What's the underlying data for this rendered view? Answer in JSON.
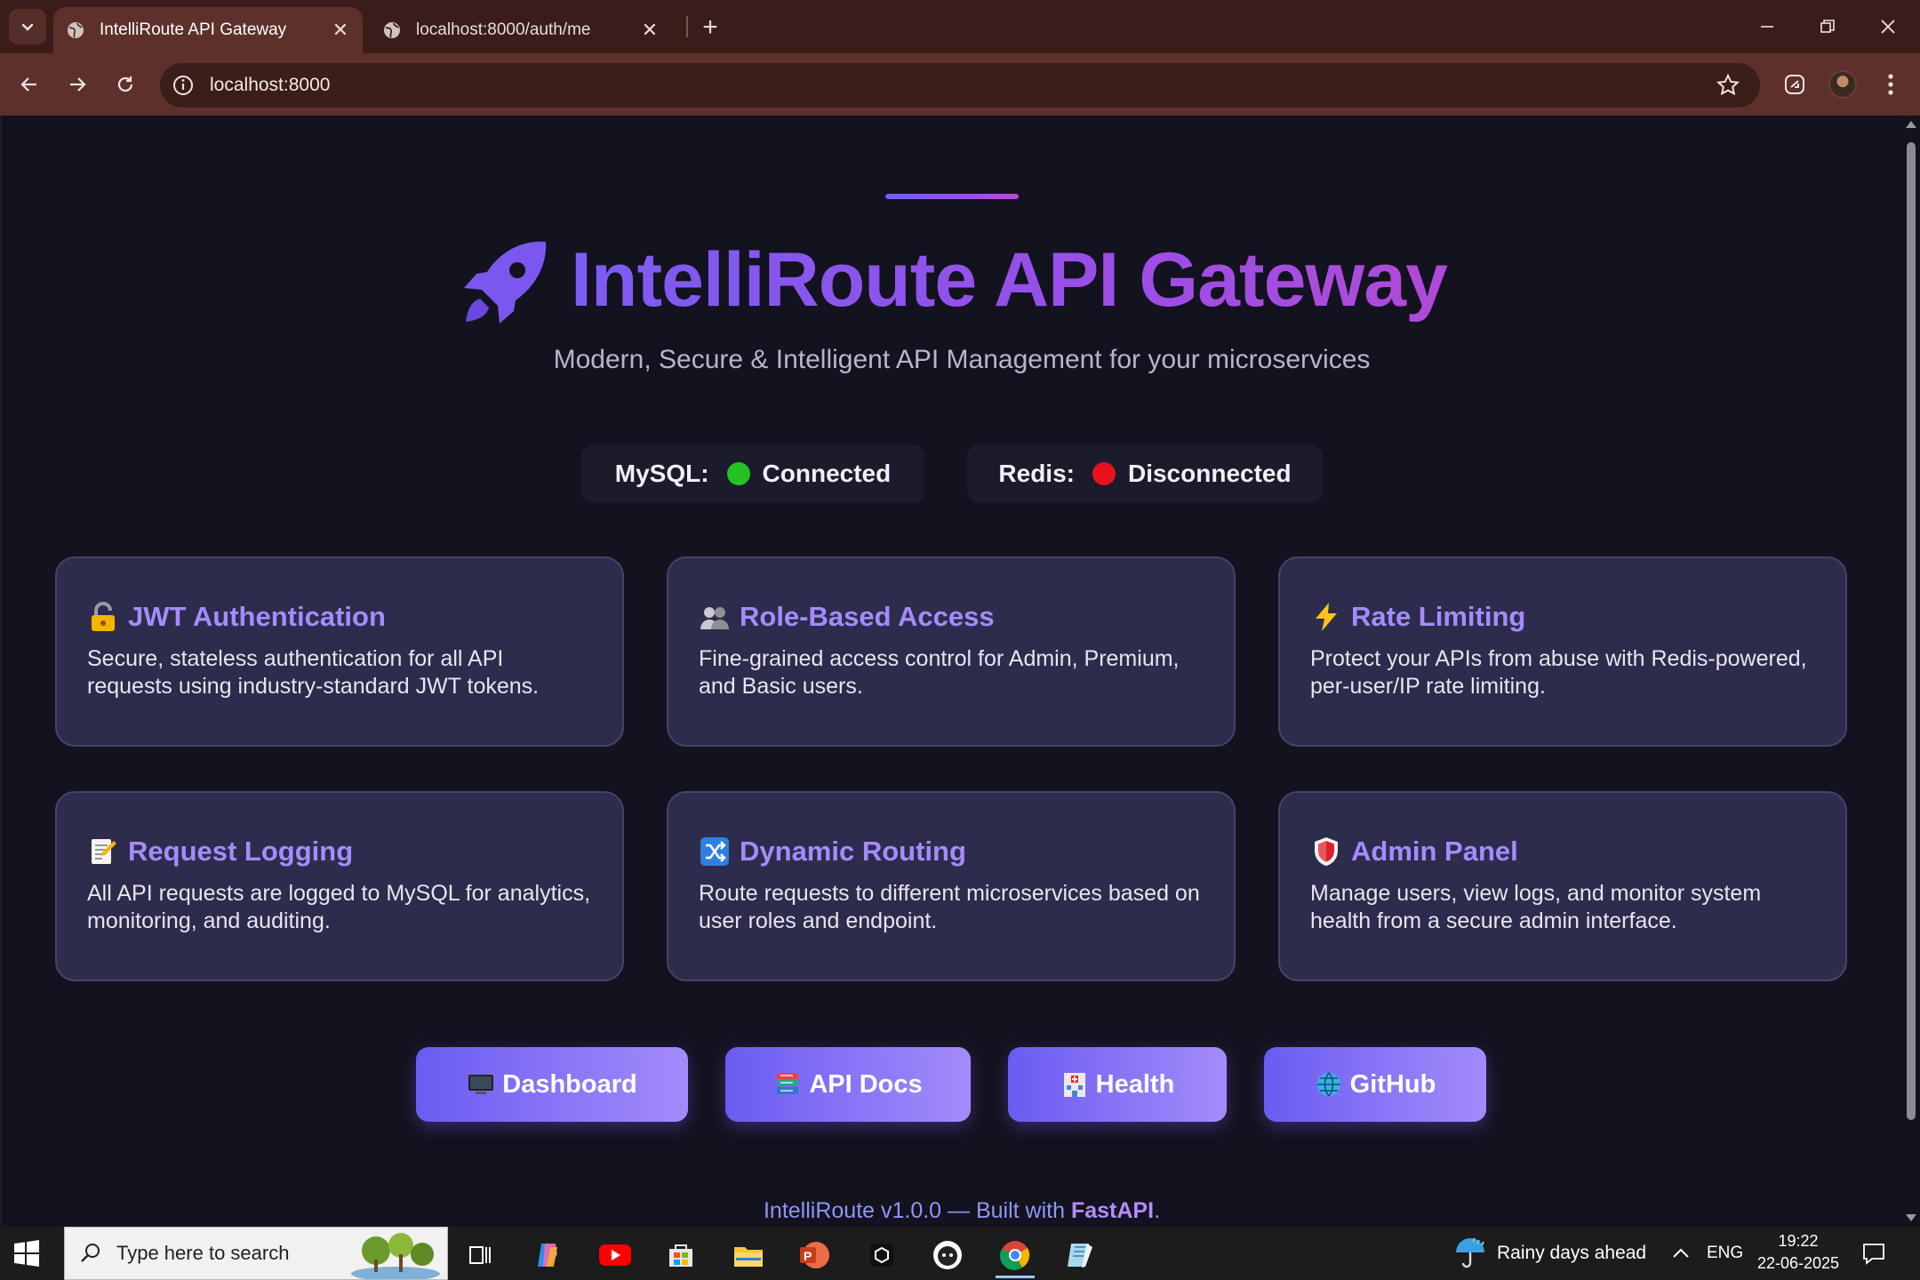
{
  "browser": {
    "tabs": [
      {
        "title": "IntelliRoute API Gateway",
        "active": true
      },
      {
        "title": "localhost:8000/auth/me",
        "active": false
      }
    ],
    "url": "localhost:8000"
  },
  "page": {
    "title": "IntelliRoute API Gateway",
    "subtitle": "Modern, Secure & Intelligent API Management for your microservices",
    "status": [
      {
        "label": "MySQL:",
        "value": "Connected",
        "color": "#22c322"
      },
      {
        "label": "Redis:",
        "value": "Disconnected",
        "color": "#e8121e"
      }
    ],
    "features": [
      {
        "icon": "lock-icon",
        "title": "JWT Authentication",
        "desc": "Secure, stateless authentication for all API requests using industry-standard JWT tokens."
      },
      {
        "icon": "users-icon",
        "title": "Role-Based Access",
        "desc": "Fine-grained access control for Admin, Premium, and Basic users."
      },
      {
        "icon": "lightning-icon",
        "title": "Rate Limiting",
        "desc": "Protect your APIs from abuse with Redis-powered, per-user/IP rate limiting."
      },
      {
        "icon": "memo-icon",
        "title": "Request Logging",
        "desc": "All API requests are logged to MySQL for analytics, monitoring, and auditing."
      },
      {
        "icon": "shuffle-icon",
        "title": "Dynamic Routing",
        "desc": "Route requests to different microservices based on user roles and endpoint."
      },
      {
        "icon": "shield-icon",
        "title": "Admin Panel",
        "desc": "Manage users, view logs, and monitor system health from a secure admin interface."
      }
    ],
    "buttons": [
      {
        "icon": "monitor-icon",
        "label": "Dashboard"
      },
      {
        "icon": "books-icon",
        "label": "API Docs"
      },
      {
        "icon": "hospital-icon",
        "label": "Health"
      },
      {
        "icon": "globe-icon",
        "label": "GitHub"
      }
    ],
    "footer": {
      "text": "IntelliRoute v1.0.0 — Built with ",
      "link": "FastAPI",
      "end": "."
    }
  },
  "taskbar": {
    "search_placeholder": "Type here to search",
    "weather": "Rainy days ahead",
    "language": "ENG",
    "time": "19:22",
    "date": "22-06-2025"
  }
}
